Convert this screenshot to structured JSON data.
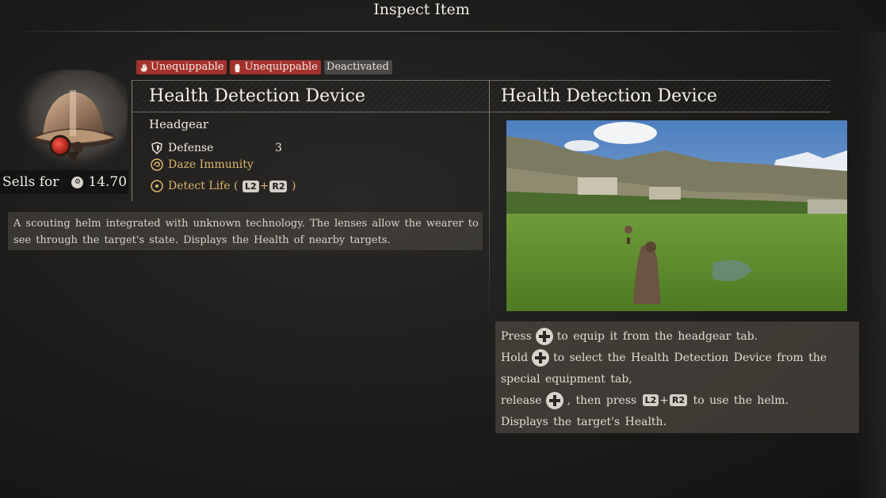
{
  "window": {
    "title": "Inspect Item"
  },
  "badges": [
    {
      "label": "Unequippable",
      "style": "red",
      "icon": "hand-icon"
    },
    {
      "label": "Unequippable",
      "style": "red",
      "icon": "glove-icon"
    },
    {
      "label": "Deactivated",
      "style": "grey"
    }
  ],
  "item": {
    "name": "Health Detection Device",
    "type": "Headgear",
    "sell_label": "Sells for",
    "sell_value": "14.70",
    "stats": {
      "defense_label": "Defense",
      "defense_value": "3",
      "daze_label": "Daze Immunity",
      "detect_label": "Detect Life (",
      "detect_close": ")",
      "key1": "L2",
      "plus": "+",
      "key2": "R2"
    },
    "description": "A scouting helm integrated with unknown technology. The lenses allow the wearer to see through the target's state. Displays the Health of nearby targets."
  },
  "preview": {
    "title": "Health Detection Device"
  },
  "tips": {
    "l1a": "Press",
    "l1b": "to equip it from the headgear tab.",
    "l2a": "Hold",
    "l2b": "to select the Health Detection Device from the",
    "l3": "special equipment tab,",
    "l4a": "release",
    "l4b": ", then press",
    "l4c": "to use the helm.",
    "l5": "Displays the target's Health.",
    "key1": "L2",
    "plus": "+",
    "key2": "R2"
  },
  "colors": {
    "accent_gold": "#dcb46a",
    "badge_red": "#a3322c"
  }
}
